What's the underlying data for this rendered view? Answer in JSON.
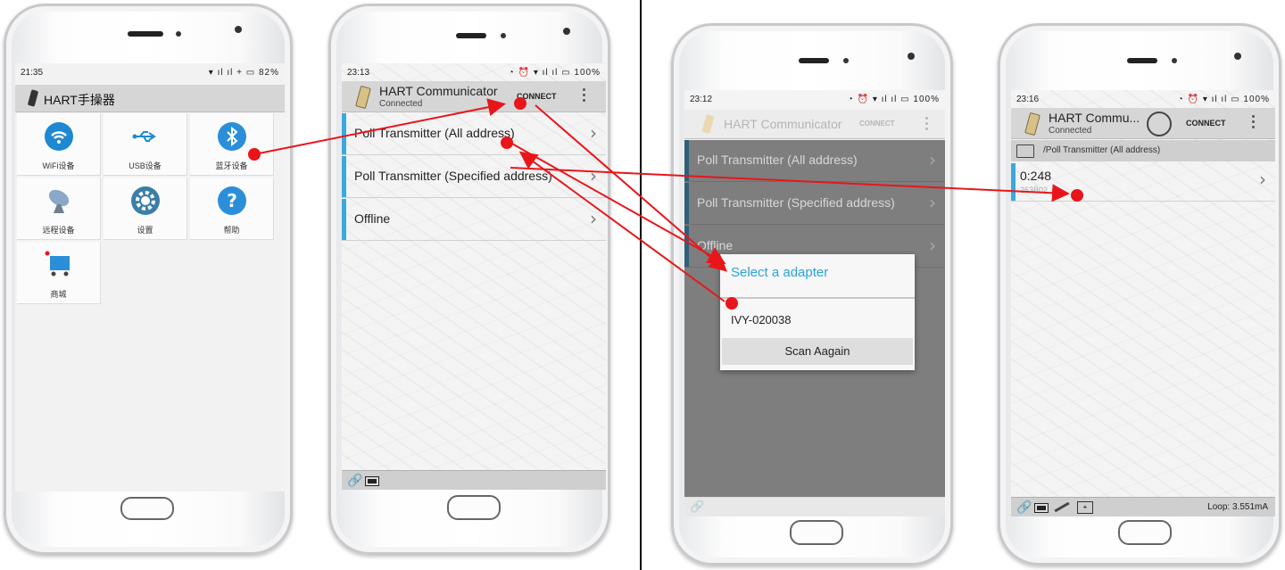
{
  "phone1": {
    "status": {
      "time": "21:35",
      "right": "▾ ıl ıl + ▭ 82%"
    },
    "title": "HART手操器",
    "tiles": [
      {
        "label": "WiFi设备",
        "icon": "wifi-icon",
        "color": "#1e88d2"
      },
      {
        "label": "USB设备",
        "icon": "usb-icon",
        "color": "#1e88d2"
      },
      {
        "label": "蓝牙设备",
        "icon": "bluetooth-icon",
        "color": "#2a8fd8"
      },
      {
        "label": "远程设备",
        "icon": "satellite-dish-icon",
        "color": "#6a8db3"
      },
      {
        "label": "设置",
        "icon": "gear-icon",
        "color": "#3b7ea8"
      },
      {
        "label": "帮助",
        "icon": "help-icon",
        "color": "#2a8fd8"
      },
      {
        "label": "商城",
        "icon": "shopping-cart-icon",
        "color": "#2a8fd8"
      }
    ]
  },
  "phone2": {
    "status": {
      "time": "23:13",
      "right": "◔ ⏰ ▾ ıl ıl ▭ 100%"
    },
    "app_title": "HART Communicator",
    "app_subtitle": "Connected",
    "connect": "CONNECT",
    "rows": [
      "Poll Transmitter (All address)",
      "Poll Transmitter (Specified address)",
      "Offline"
    ]
  },
  "phone3": {
    "status": {
      "time": "23:12",
      "right": "◔ ⏰ ▾ ıl ıl ▭ 100%"
    },
    "app_title": "HART Communicator",
    "connect": "CONNECT",
    "rows": [
      "Poll Transmitter (All address)",
      "Poll Transmitter (Specified address)",
      "Offline"
    ],
    "dialog": {
      "title": "Select a adapter",
      "item": "IVY-020038",
      "button": "Scan Aagain"
    }
  },
  "phone4": {
    "status": {
      "time": "23:16",
      "right": "◔ ⏰ ▾ ıl ıl ▭ 100%"
    },
    "app_title": "HART Commu...",
    "app_subtitle": "Connected",
    "connect": "CONNECT",
    "path": "/Poll Transmitter (All address)",
    "device_addr": "0:248",
    "device_id": "263B02",
    "loop": "Loop: 3.551mA"
  },
  "colors": {
    "accent": "#3aa9dd",
    "annotation": "#e8161b",
    "appbar": "#d6d6d6"
  }
}
